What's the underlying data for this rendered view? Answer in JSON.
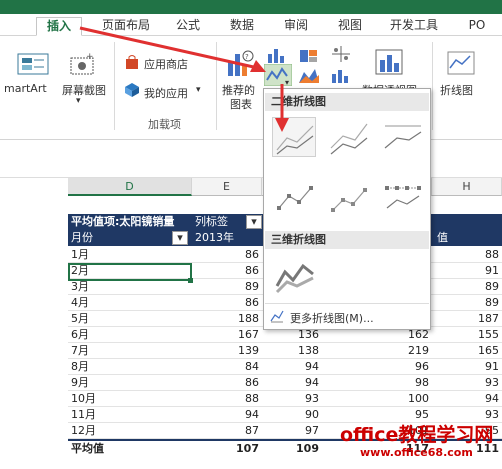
{
  "tabs": [
    {
      "label": "插入",
      "active": true
    },
    {
      "label": "页面布局"
    },
    {
      "label": "公式"
    },
    {
      "label": "数据"
    },
    {
      "label": "审阅"
    },
    {
      "label": "视图"
    },
    {
      "label": "开发工具"
    },
    {
      "label": "PO"
    }
  ],
  "ribbon": {
    "smartart": "martArt",
    "screenshot_line1": "屏幕截图",
    "store": "应用商店",
    "myapps": "我的应用",
    "addins_group": "加载项",
    "recommended_line1": "推荐的",
    "recommended_line2": "图表",
    "pivotchart": "数据透视图",
    "line_btn": "折线图"
  },
  "columns": [
    "D",
    "E",
    "F",
    "G",
    "H"
  ],
  "pivot": {
    "header_label": "平均值项:太阳镜销量",
    "col_label": "列标签",
    "row_label": "月份",
    "year1": "2013年",
    "h_tail": "值",
    "total_label": "平均值",
    "rows": [
      {
        "m": "1月",
        "a": "86",
        "h": "88"
      },
      {
        "m": "2月",
        "a": "86",
        "h": "91"
      },
      {
        "m": "3月",
        "a": "89",
        "h": "89"
      },
      {
        "m": "4月",
        "a": "86",
        "h": "89"
      },
      {
        "m": "5月",
        "a": "188",
        "h": "187"
      },
      {
        "m": "6月",
        "a": "167",
        "b": "136",
        "c": "162",
        "h": "155"
      },
      {
        "m": "7月",
        "a": "139",
        "b": "138",
        "c": "219",
        "h": "165"
      },
      {
        "m": "8月",
        "a": "84",
        "b": "94",
        "c": "96",
        "h": "91"
      },
      {
        "m": "9月",
        "a": "86",
        "b": "94",
        "c": "98",
        "h": "93"
      },
      {
        "m": "10月",
        "a": "88",
        "b": "93",
        "c": "100",
        "h": "94"
      },
      {
        "m": "11月",
        "a": "94",
        "b": "90",
        "c": "95",
        "h": "93"
      },
      {
        "m": "12月",
        "a": "87",
        "b": "97",
        "c": "101",
        "h": "95"
      }
    ],
    "total": {
      "a": "107",
      "b": "109",
      "c": "117",
      "h": "111"
    }
  },
  "gallery": {
    "section1": "二维折线图",
    "section2": "三维折线图",
    "more": "更多折线图(M)..."
  },
  "watermark": {
    "line1": "office教程学习网",
    "line2": "www.office68.com"
  },
  "colors": {
    "excel_green": "#217346",
    "arrow_red": "#e03030"
  }
}
